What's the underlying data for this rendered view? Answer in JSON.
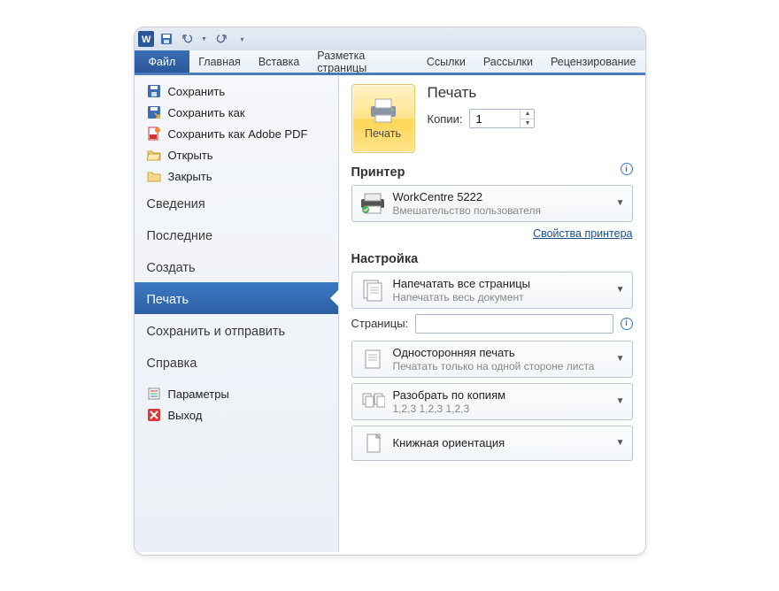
{
  "ribbon": {
    "file": "Файл",
    "tabs": [
      "Главная",
      "Вставка",
      "Разметка страницы",
      "Ссылки",
      "Рассылки",
      "Рецензирование"
    ]
  },
  "backstage": {
    "quick": [
      {
        "icon": "save",
        "label": "Сохранить"
      },
      {
        "icon": "saveas",
        "label": "Сохранить как"
      },
      {
        "icon": "pdf",
        "label": "Сохранить как Adobe PDF"
      },
      {
        "icon": "open",
        "label": "Открыть"
      },
      {
        "icon": "close",
        "label": "Закрыть"
      }
    ],
    "sections": [
      "Сведения",
      "Последние",
      "Создать",
      "Печать",
      "Сохранить и отправить",
      "Справка"
    ],
    "active": "Печать",
    "bottom": [
      {
        "icon": "options",
        "label": "Параметры"
      },
      {
        "icon": "exit",
        "label": "Выход"
      }
    ]
  },
  "print": {
    "title": "Печать",
    "button": "Печать",
    "copies_label": "Копии:",
    "copies_value": "1",
    "printer_section": "Принтер",
    "printer_name": "WorkCentre 5222",
    "printer_status": "Вмешательство пользователя",
    "printer_props": "Свойства принтера",
    "settings_section": "Настройка",
    "pages_label": "Страницы:",
    "pages_value": "",
    "opts": [
      {
        "t1": "Напечатать все страницы",
        "t2": "Напечатать весь документ",
        "icon": "pages"
      },
      {
        "t1": "Односторонняя печать",
        "t2": "Печатать только на одной стороне листа",
        "icon": "oneside"
      },
      {
        "t1": "Разобрать по копиям",
        "t2": "1,2,3    1,2,3    1,2,3",
        "icon": "collate"
      },
      {
        "t1": "Книжная ориентация",
        "t2": "",
        "icon": "portrait"
      }
    ]
  }
}
